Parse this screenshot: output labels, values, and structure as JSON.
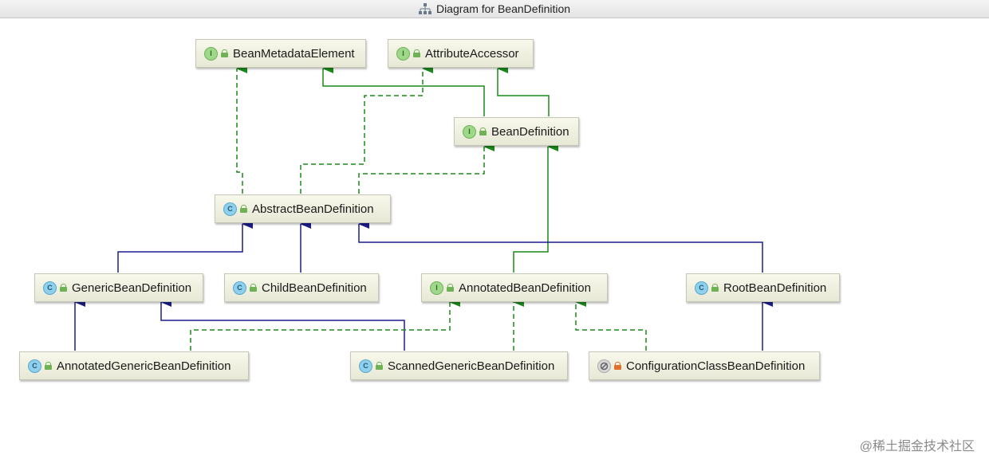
{
  "window": {
    "title": "Diagram for BeanDefinition"
  },
  "nodes": {
    "bean_metadata_element": {
      "label": "BeanMetadataElement",
      "kind": "interface"
    },
    "attribute_accessor": {
      "label": "AttributeAccessor",
      "kind": "interface"
    },
    "bean_definition": {
      "label": "BeanDefinition",
      "kind": "interface"
    },
    "abstract_bean_definition": {
      "label": "AbstractBeanDefinition",
      "kind": "class"
    },
    "generic_bean_definition": {
      "label": "GenericBeanDefinition",
      "kind": "class"
    },
    "child_bean_definition": {
      "label": "ChildBeanDefinition",
      "kind": "class"
    },
    "annotated_bean_definition": {
      "label": "AnnotatedBeanDefinition",
      "kind": "interface"
    },
    "root_bean_definition": {
      "label": "RootBeanDefinition",
      "kind": "class"
    },
    "annotated_generic_bean_definition": {
      "label": "AnnotatedGenericBeanDefinition",
      "kind": "class"
    },
    "scanned_generic_bean_definition": {
      "label": "ScannedGenericBeanDefinition",
      "kind": "class"
    },
    "configuration_class_bean_definition": {
      "label": "ConfigurationClassBeanDefinition",
      "kind": "class"
    }
  },
  "badges": {
    "interface": "I",
    "class": "C"
  },
  "colors": {
    "implements": "#1a8a1a",
    "extends": "#1c1c8c",
    "node_border": "#c6c6b4"
  },
  "watermark": "@稀土掘金技术社区"
}
